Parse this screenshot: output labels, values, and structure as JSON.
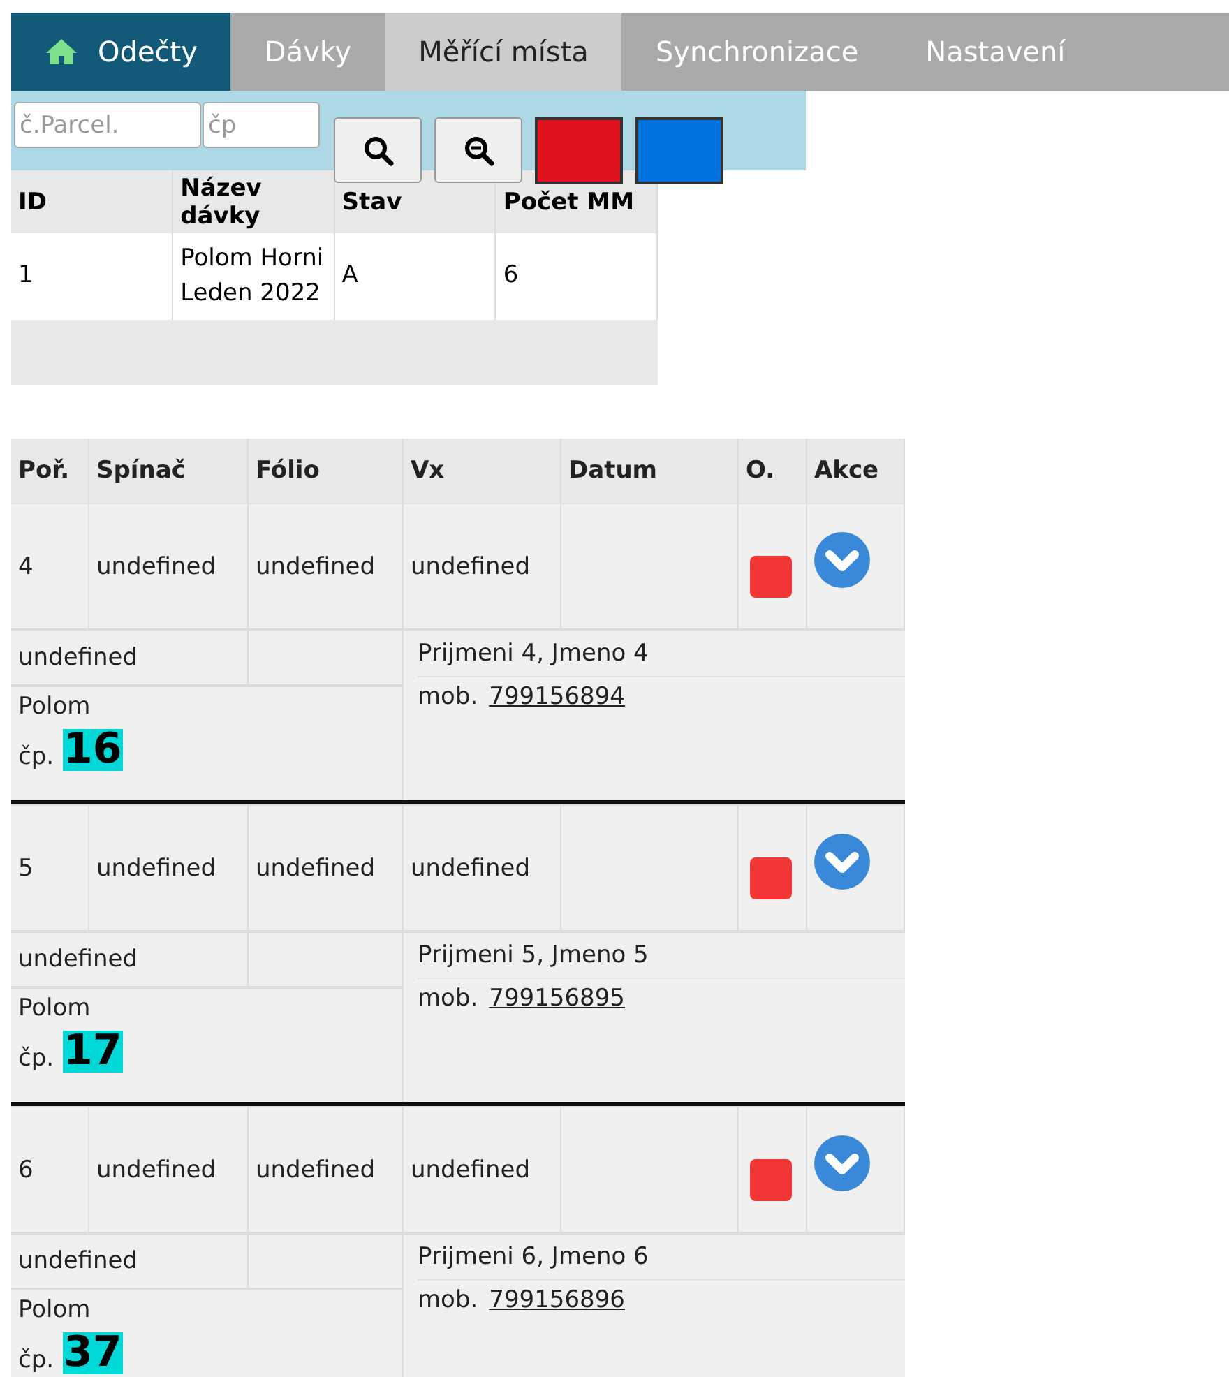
{
  "tabs": [
    {
      "label": "Odečty",
      "kind": "home",
      "selected": false
    },
    {
      "label": "Dávky",
      "kind": "plain",
      "selected": false
    },
    {
      "label": "Měřící místa",
      "kind": "plain",
      "selected": true
    },
    {
      "label": "Synchronizace",
      "kind": "plain",
      "selected": false
    },
    {
      "label": "Nastavení",
      "kind": "plain",
      "selected": false
    }
  ],
  "search": {
    "fields": [
      {
        "placeholder": "č.Parcel."
      },
      {
        "placeholder": "čp"
      }
    ],
    "buttons": [
      {
        "kind": "search"
      },
      {
        "kind": "zoom-out"
      },
      {
        "kind": "swatch",
        "color": "#e0121f"
      },
      {
        "kind": "swatch",
        "color": "#0073e0"
      }
    ]
  },
  "batches": {
    "columns": [
      "ID",
      "Název dávky",
      "Stav",
      "Počet MM"
    ],
    "rows": [
      {
        "cells": [
          "1",
          "Polom Horni Leden 2022",
          "A",
          "6"
        ]
      }
    ]
  },
  "records": {
    "columns": [
      "Poř.",
      "Spínač",
      "Fólio",
      "Vx",
      "Datum",
      "O.",
      "Akce"
    ],
    "rows": [
      {
        "order": "4",
        "switch": "undefined",
        "folio": "undefined",
        "vx": "undefined",
        "color": "#f23636",
        "extra": "undefined",
        "place": "Polom",
        "house_label": "čp.",
        "house_number": "16",
        "name": "Prijmeni 4, Jmeno 4",
        "phone_label": "mob.",
        "phone": "799156894"
      },
      {
        "order": "5",
        "switch": "undefined",
        "folio": "undefined",
        "vx": "undefined",
        "color": "#f23636",
        "extra": "undefined",
        "place": "Polom",
        "house_label": "čp.",
        "house_number": "17",
        "name": "Prijmeni 5, Jmeno 5",
        "phone_label": "mob.",
        "phone": "799156895"
      },
      {
        "order": "6",
        "switch": "undefined",
        "folio": "undefined",
        "vx": "undefined",
        "color": "#f23636",
        "extra": "undefined",
        "place": "Polom",
        "house_label": "čp.",
        "house_number": "37",
        "name": "Prijmeni 6, Jmeno 6",
        "phone_label": "mob.",
        "phone": "799156896"
      }
    ]
  }
}
